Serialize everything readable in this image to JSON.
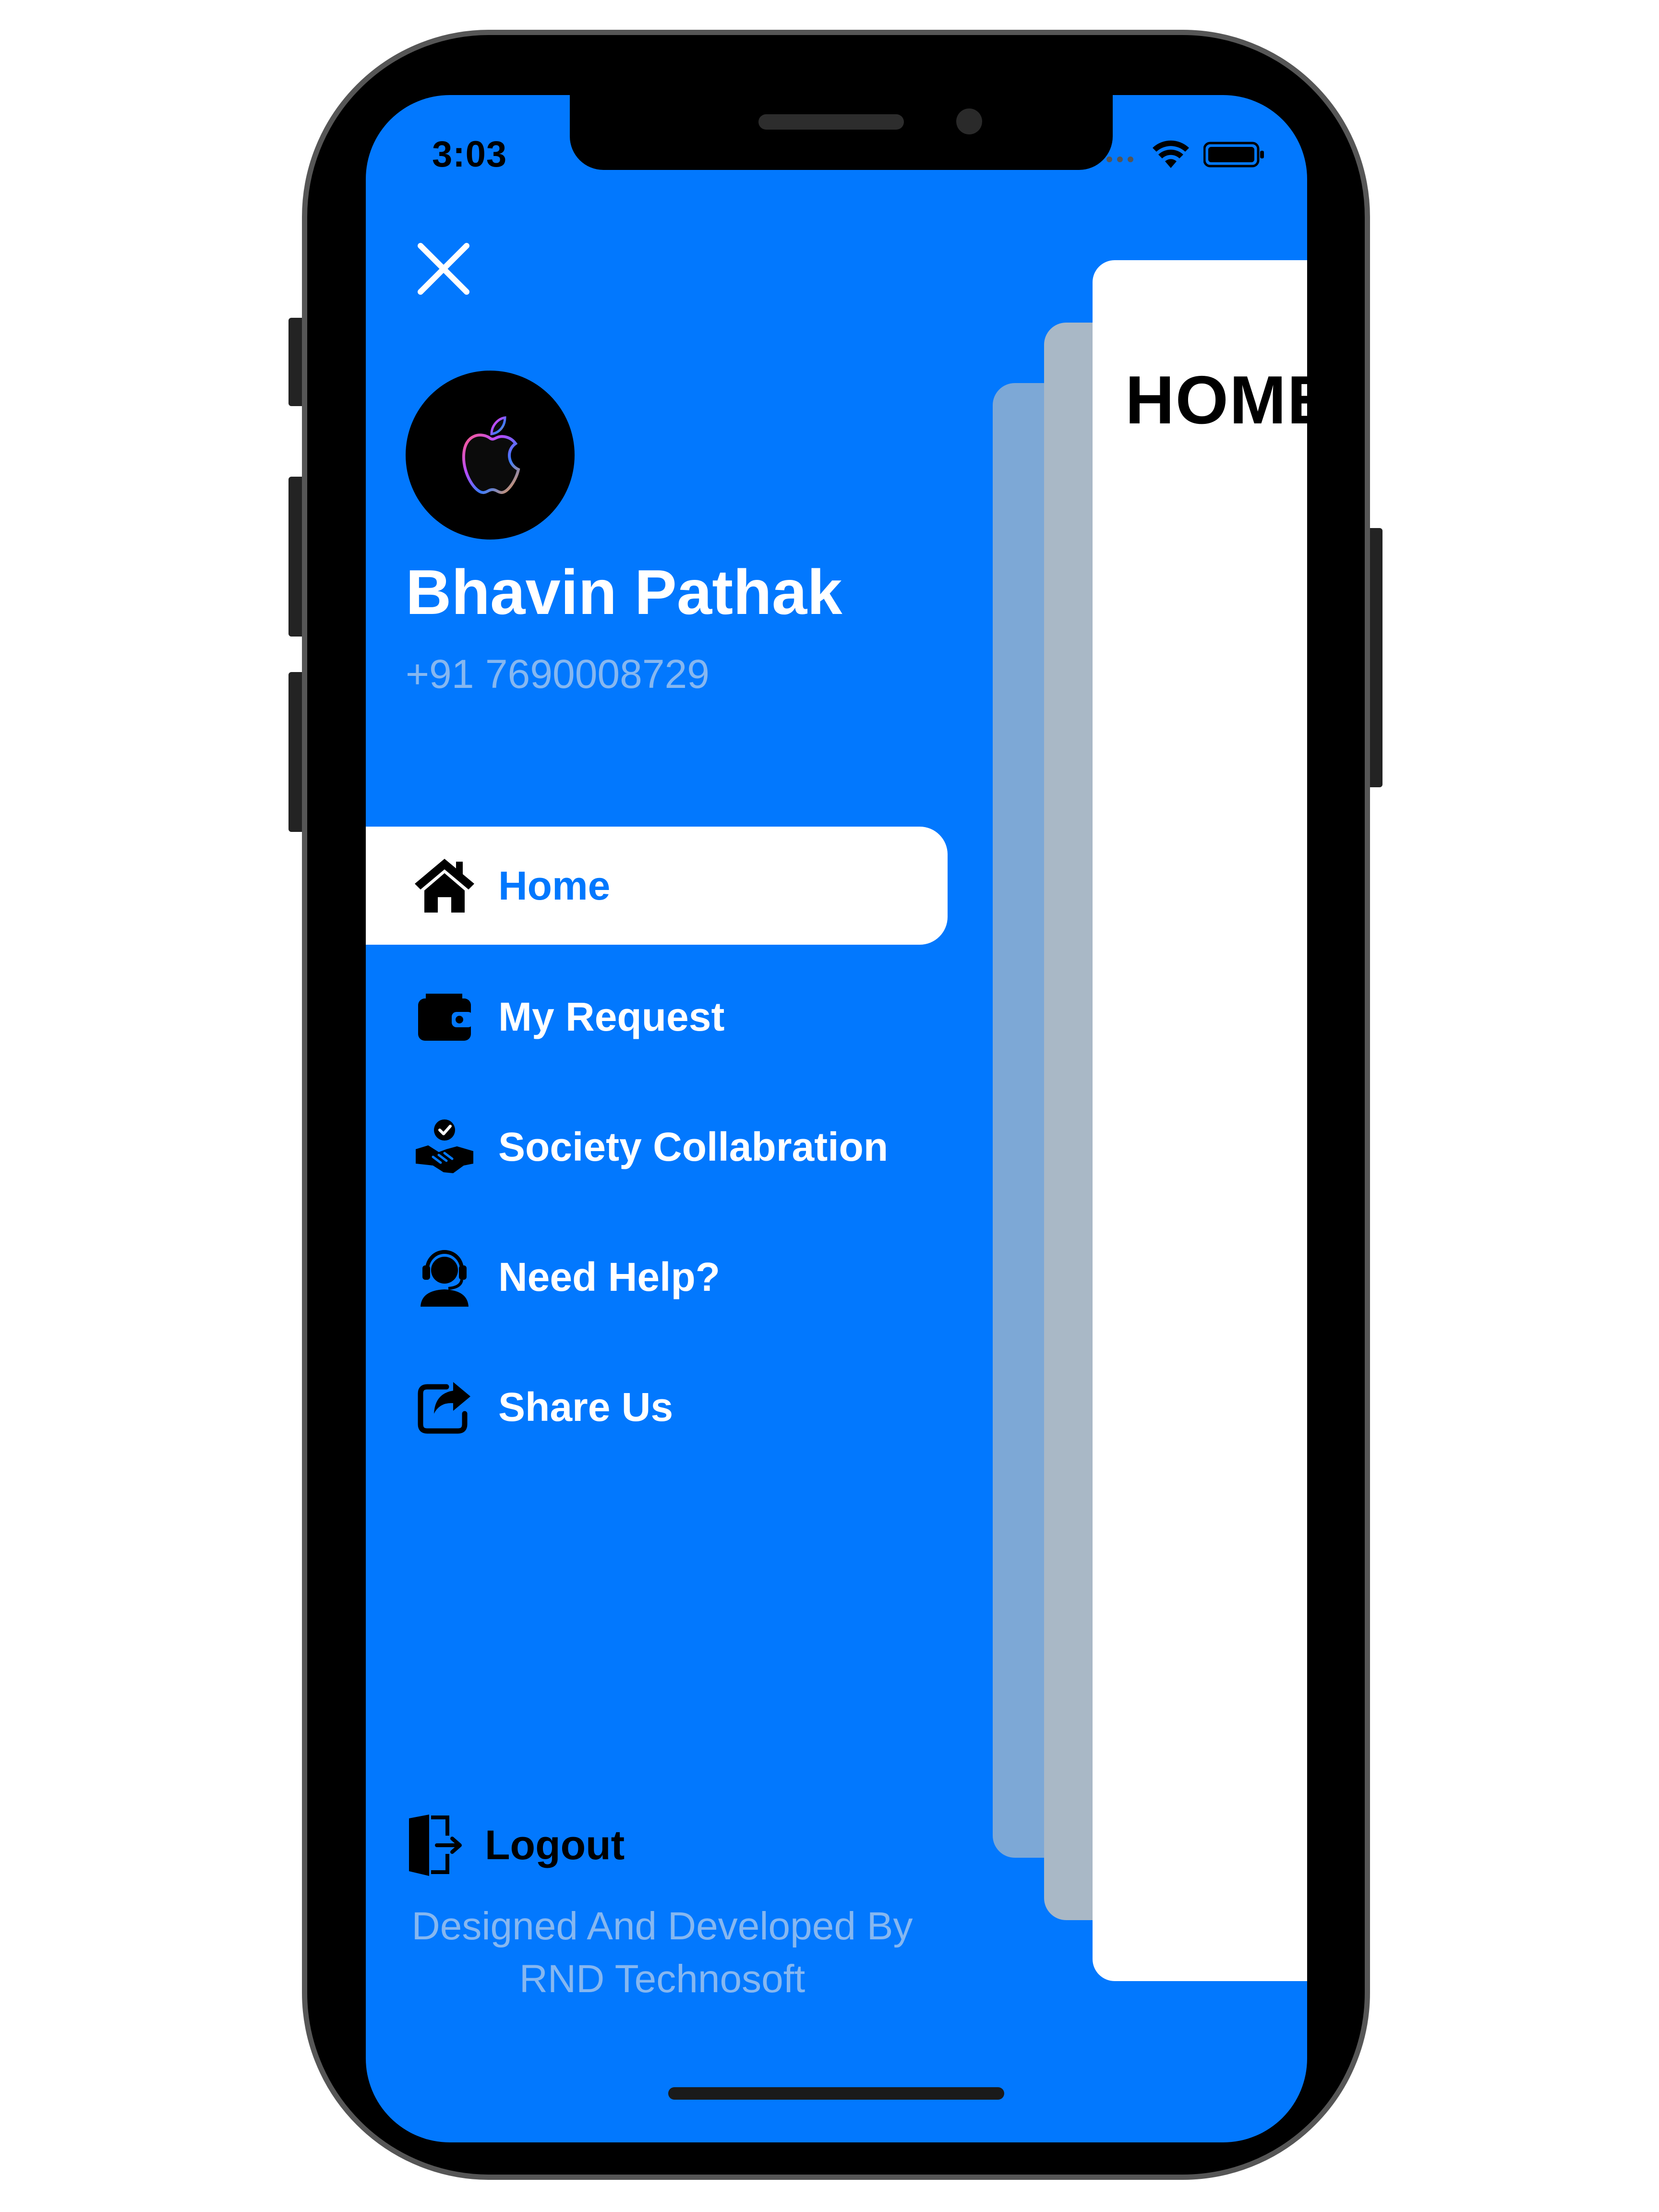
{
  "status_bar": {
    "time": "3:03"
  },
  "preview": {
    "title": "HOME"
  },
  "profile": {
    "name": "Bhavin Pathak",
    "phone": "+91 7690008729"
  },
  "menu": {
    "items": [
      {
        "label": "Home",
        "icon": "home-icon"
      },
      {
        "label": "My Request",
        "icon": "wallet-icon"
      },
      {
        "label": "Society Collabration",
        "icon": "handshake-icon"
      },
      {
        "label": "Need Help?",
        "icon": "support-agent-icon"
      },
      {
        "label": "Share Us",
        "icon": "share-icon"
      }
    ],
    "active_index": 0
  },
  "logout": {
    "label": "Logout"
  },
  "footer": {
    "line1": "Designed And Developed By",
    "line2": "RND Technosoft"
  },
  "colors": {
    "drawer_bg": "#0278fe",
    "accent": "#0278fe",
    "muted_text": "#86b7f0"
  }
}
